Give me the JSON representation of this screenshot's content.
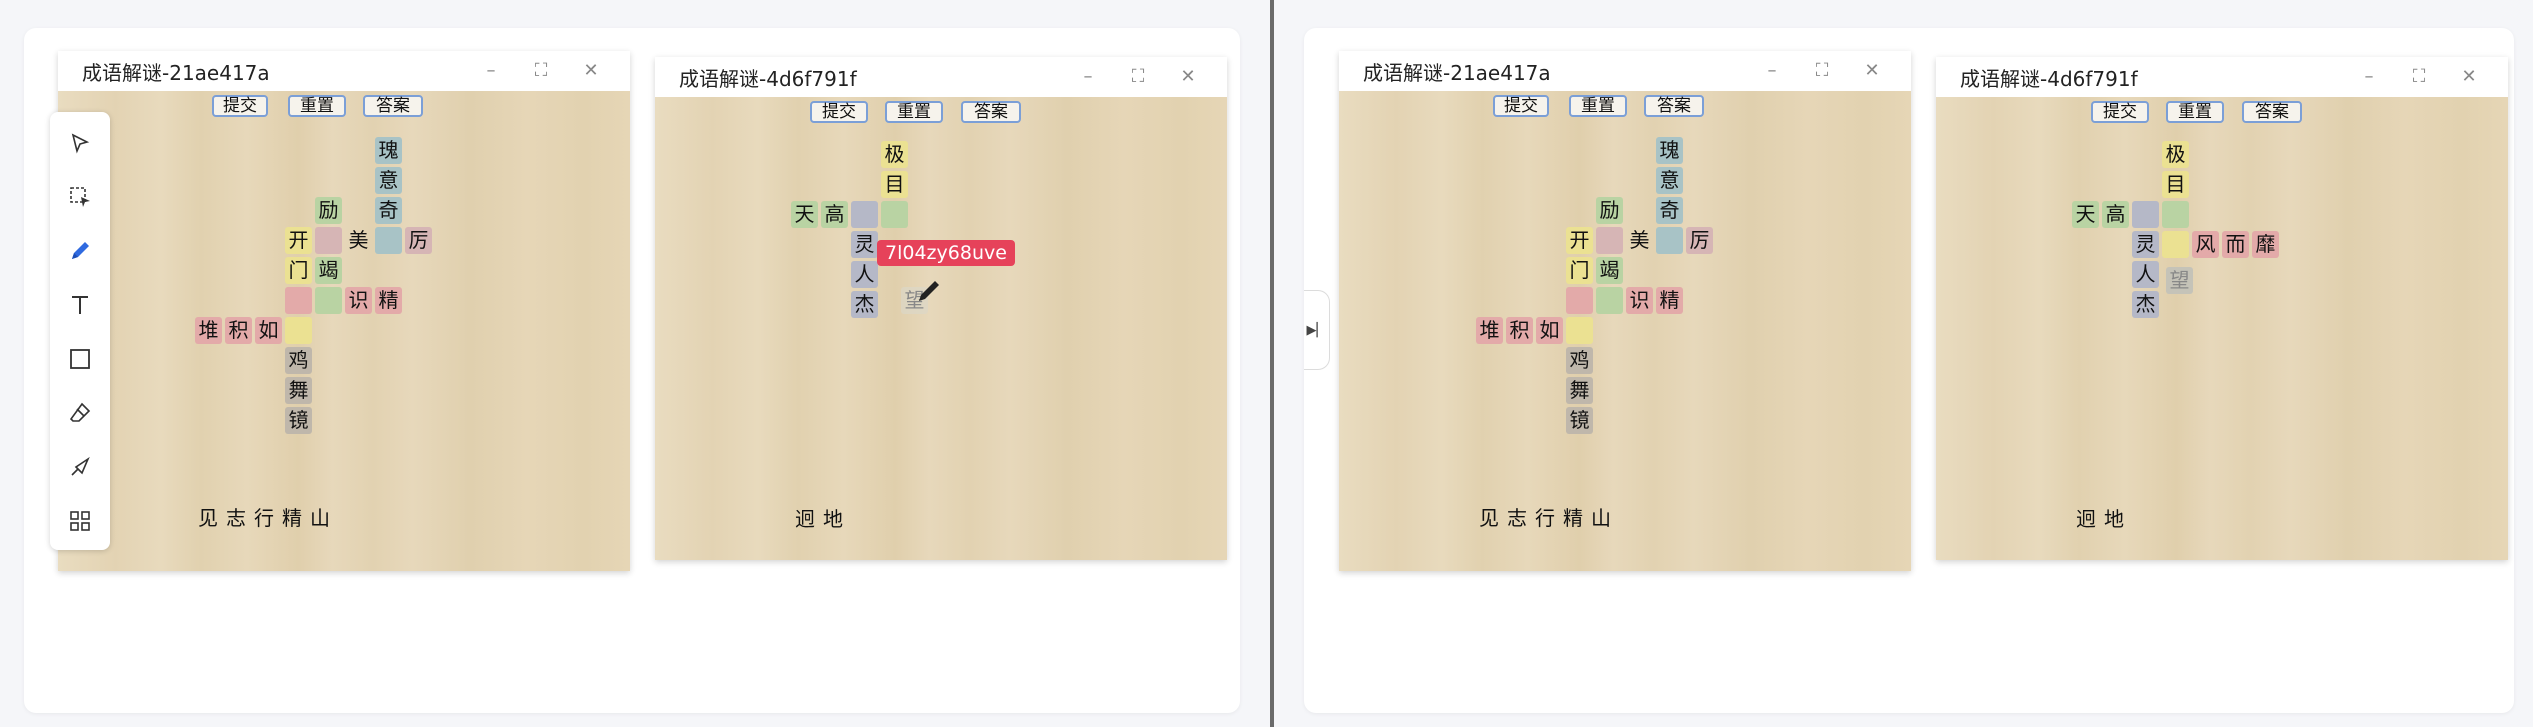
{
  "left_pane": {
    "window_a": {
      "title": "成语解谜-21ae417a",
      "buttons": {
        "submit": "提交",
        "reset": "重置",
        "answer": "答案"
      },
      "cells": [
        "瑰",
        "意",
        "奇",
        "励",
        "开",
        "美",
        "厉",
        "门",
        "竭",
        "识",
        "精",
        "堆",
        "积",
        "如",
        "鸡",
        "舞",
        "镜"
      ],
      "pool": "见志行精山"
    },
    "window_b": {
      "title": "成语解谜-4d6f791f",
      "buttons": {
        "submit": "提交",
        "reset": "重置",
        "answer": "答案"
      },
      "cells": [
        "极",
        "目",
        "天",
        "高",
        "灵",
        "人",
        "杰",
        "望"
      ],
      "pool": "迥地",
      "cursor_tag": "7l04zy68uve"
    }
  },
  "right_pane": {
    "window_a": {
      "title": "成语解谜-21ae417a",
      "buttons": {
        "submit": "提交",
        "reset": "重置",
        "answer": "答案"
      },
      "cells": [
        "瑰",
        "意",
        "奇",
        "励",
        "开",
        "美",
        "厉",
        "门",
        "竭",
        "识",
        "精",
        "堆",
        "积",
        "如",
        "鸡",
        "舞",
        "镜"
      ],
      "pool": "见志行精山"
    },
    "window_b": {
      "title": "成语解谜-4d6f791f",
      "buttons": {
        "submit": "提交",
        "reset": "重置",
        "answer": "答案"
      },
      "cells": [
        "极",
        "目",
        "天",
        "高",
        "灵",
        "风",
        "而",
        "靡",
        "人",
        "望",
        "杰"
      ],
      "pool": "迥地"
    }
  },
  "icons": [
    "select-arrow-icon",
    "lasso-select-icon",
    "pen-icon",
    "text-icon",
    "rectangle-icon",
    "eraser-icon",
    "laser-icon",
    "grid-icon",
    "minimize-icon",
    "maximize-icon",
    "close-icon",
    "collapse-arrow-icon"
  ]
}
